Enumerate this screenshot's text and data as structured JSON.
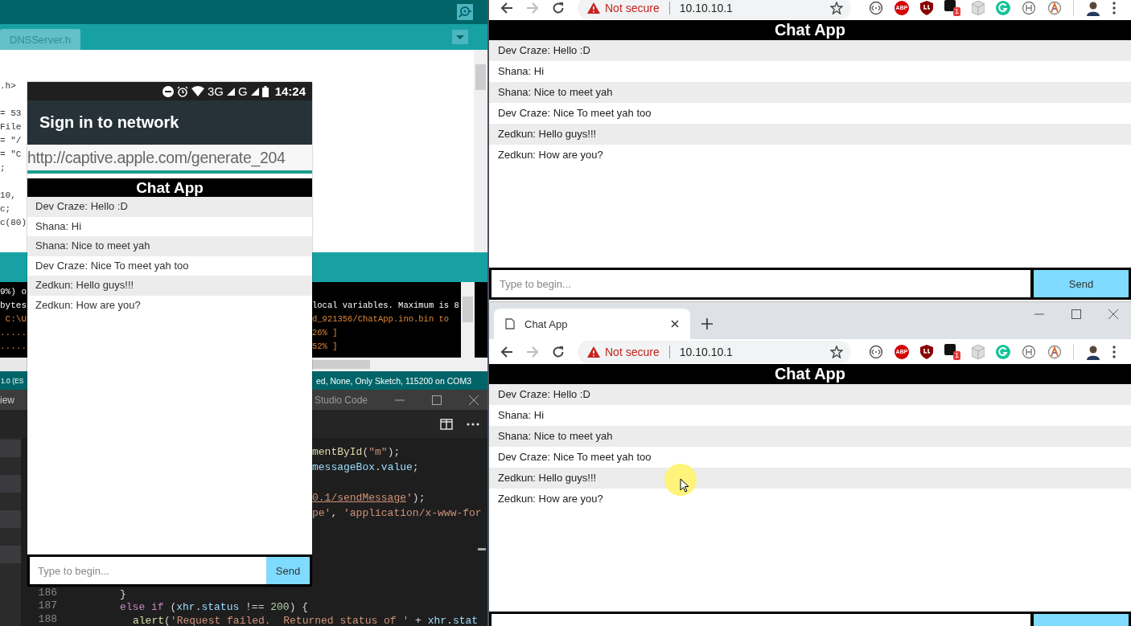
{
  "arduino": {
    "tabs": [
      {
        "label": "DNSServer.h",
        "selected": false
      }
    ],
    "code_lines": [
      {
        "kind": "text",
        "text": ".h>"
      },
      {
        "kind": "blank"
      },
      {
        "kind": "text",
        "text": "= 53"
      },
      {
        "kind": "text",
        "text": "File"
      },
      {
        "kind": "text",
        "text": "= \"/"
      },
      {
        "kind": "text",
        "text": "= \"C"
      },
      {
        "kind": "text",
        "text": ";"
      },
      {
        "kind": "blank"
      },
      {
        "kind": "text",
        "text": "10,"
      },
      {
        "kind": "text",
        "text": "c;"
      },
      {
        "kind": "text",
        "text": "c(80)"
      }
    ],
    "console": [
      {
        "kind": "log",
        "left": "9%) o"
      },
      {
        "kind": "log",
        "left": "bytes",
        "right": "local variables. Maximum is 8"
      },
      {
        "kind": "upload",
        "left": " C:\\U",
        "right": "d_921356/ChatApp.ino.bin to"
      },
      {
        "kind": "upload",
        "left": ".....",
        "right": "26% ]"
      },
      {
        "kind": "upload",
        "left": ".....",
        "right": "52% ]"
      }
    ],
    "status_left": "1.0 (ES",
    "status_right": "ed, None, Only Sketch, 115200 on COM3"
  },
  "vscode": {
    "menu_fragment": "iew",
    "title": "Studio Code",
    "top_lines": [
      {
        "kind": "text",
        "segments": [
          {
            "text": "mentById",
            "kind": "fn"
          },
          {
            "text": "(",
            "kind": "plain"
          },
          {
            "text": "\"m\"",
            "kind": "str"
          },
          {
            "text": ");",
            "kind": "plain"
          }
        ]
      },
      {
        "kind": "text",
        "segments": [
          {
            "text": "messageBox",
            "kind": "var"
          },
          {
            "text": ".",
            "kind": "plain"
          },
          {
            "text": "value",
            "kind": "var"
          },
          {
            "text": ";",
            "kind": "plain"
          }
        ]
      },
      {
        "kind": "blank"
      },
      {
        "kind": "text",
        "segments": [
          {
            "text": "0.1/sendMessage",
            "kind": "link"
          },
          {
            "text": "'",
            "kind": "str"
          },
          {
            "text": ");",
            "kind": "plain"
          }
        ]
      },
      {
        "kind": "text",
        "segments": [
          {
            "text": "pe'",
            "kind": "str"
          },
          {
            "text": ", ",
            "kind": "plain"
          },
          {
            "text": "'application/x-www-for",
            "kind": "str"
          }
        ]
      }
    ],
    "bottom_lines": [
      {
        "number": "186",
        "segments": [
          {
            "text": "}",
            "kind": "plain"
          }
        ]
      },
      {
        "number": "187",
        "segments": [
          {
            "text": "else if",
            "kind": "kw"
          },
          {
            "text": " (",
            "kind": "plain"
          },
          {
            "text": "xhr",
            "kind": "var"
          },
          {
            "text": ".",
            "kind": "plain"
          },
          {
            "text": "status",
            "kind": "var"
          },
          {
            "text": " !== ",
            "kind": "plain"
          },
          {
            "text": "200",
            "kind": "num"
          },
          {
            "text": ") {",
            "kind": "plain"
          }
        ],
        "children": [
          {
            "number": "188",
            "segments": [
              {
                "text": "alert",
                "kind": "fn"
              },
              {
                "text": "(",
                "kind": "plain"
              },
              {
                "text": "'Request failed.  Returned status of '",
                "kind": "str"
              },
              {
                "text": " + ",
                "kind": "plain"
              },
              {
                "text": "xhr",
                "kind": "var"
              },
              {
                "text": ".",
                "kind": "plain"
              },
              {
                "text": "stat",
                "kind": "var"
              }
            ]
          }
        ]
      }
    ]
  },
  "phone": {
    "network_1": "3G",
    "network_2": "G",
    "time": "14:24",
    "title": "Sign in to network",
    "url": "http://captive.apple.com/generate_204",
    "chat": {
      "title": "Chat App",
      "messages": [
        "Dev Craze: Hello :D",
        "Shana: Hi",
        "Shana: Nice to meet yah",
        "Dev Craze: Nice To meet yah too",
        "Zedkun: Hello guys!!!",
        "Zedkun: How are you?"
      ],
      "placeholder": "Type to begin...",
      "send": "Send"
    }
  },
  "browsers": [
    {
      "forward_disabled": true,
      "security": "Not secure",
      "url": "10.10.10.1",
      "abp": "ABP",
      "badge": "1",
      "chat": {
        "title": "Chat App",
        "messages": [
          "Dev Craze: Hello :D",
          "Shana: Hi",
          "Shana: Nice to meet yah",
          "Dev Craze: Nice To meet yah too",
          "Zedkun: Hello guys!!!",
          "Zedkun: How are you?"
        ],
        "placeholder": "Type to begin...",
        "send": "Send"
      }
    },
    {
      "tabs": [
        {
          "title": "Chat App",
          "selected": true
        }
      ],
      "forward_disabled": true,
      "security": "Not secure",
      "url": "10.10.10.1",
      "abp": "ABP",
      "badge": "1",
      "chat": {
        "title": "Chat App",
        "messages": [
          "Dev Craze: Hello :D",
          "Shana: Hi",
          "Shana: Nice to meet yah",
          "Dev Craze: Nice To meet yah too",
          "Zedkun: Hello guys!!!",
          "Zedkun: How are you?"
        ]
      }
    }
  ]
}
